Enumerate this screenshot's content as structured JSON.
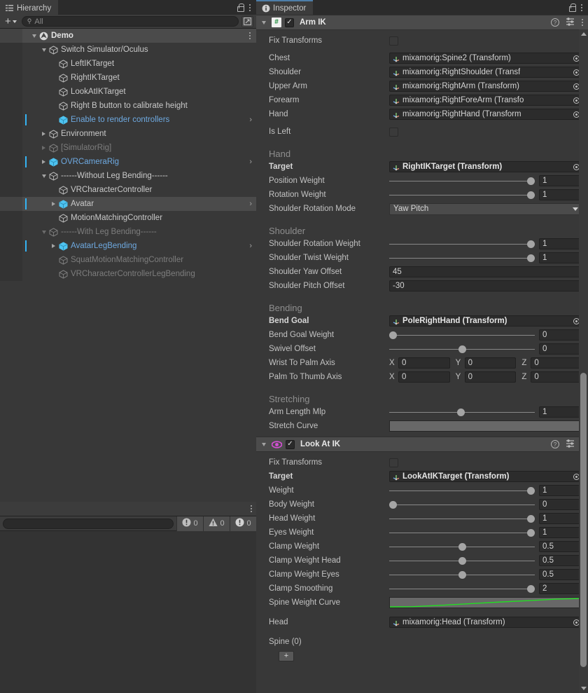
{
  "hierarchy": {
    "tab_label": "Hierarchy",
    "tab_icon": "hierarchy-icon",
    "lock_icon": "lock-icon",
    "menu_icon": "kebab-icon",
    "toolbar": {
      "create_label": "+",
      "search_placeholder": "All",
      "search_value": "",
      "search_icon": "search-icon",
      "filter_icon": "expand-window-icon"
    },
    "items": [
      {
        "label": "Demo",
        "indent": 0,
        "icon": "unity-scene-icon",
        "twisty": "down",
        "style": "white",
        "scene": true,
        "kebab": true
      },
      {
        "label": "Switch Simulator/Oculus",
        "indent": 1,
        "icon": "gameobject-icon",
        "twisty": "down",
        "style": "normal"
      },
      {
        "label": "LeftIKTarget",
        "indent": 2,
        "icon": "gameobject-icon",
        "twisty": "none",
        "style": "normal"
      },
      {
        "label": "RightIKTarget",
        "indent": 2,
        "icon": "gameobject-icon",
        "twisty": "none",
        "style": "normal"
      },
      {
        "label": "LookAtIKTarget",
        "indent": 2,
        "icon": "gameobject-icon",
        "twisty": "none",
        "style": "normal"
      },
      {
        "label": "Right B button to calibrate height",
        "indent": 2,
        "icon": "gameobject-icon",
        "twisty": "none",
        "style": "normal"
      },
      {
        "label": "Enable to render controllers",
        "indent": 2,
        "icon": "prefab-icon",
        "twisty": "none",
        "style": "blue",
        "prefab": true,
        "arrow": true
      },
      {
        "label": "Environment",
        "indent": 1,
        "icon": "gameobject-icon",
        "twisty": "right",
        "style": "normal"
      },
      {
        "label": "[SimulatorRig]",
        "indent": 1,
        "icon": "gameobject-icon",
        "twisty": "right",
        "style": "dim"
      },
      {
        "label": "OVRCameraRig",
        "indent": 1,
        "icon": "prefab-icon",
        "twisty": "right",
        "style": "blue",
        "prefab": true,
        "arrow": true
      },
      {
        "label": "------Without Leg Bending------",
        "indent": 1,
        "icon": "gameobject-icon",
        "twisty": "down",
        "style": "normal"
      },
      {
        "label": "VRCharacterController",
        "indent": 2,
        "icon": "gameobject-icon",
        "twisty": "none",
        "style": "normal"
      },
      {
        "label": "Avatar",
        "indent": 2,
        "icon": "prefab-icon",
        "twisty": "right",
        "style": "normal",
        "prefab": true,
        "arrow": true,
        "selected": true
      },
      {
        "label": "MotionMatchingController",
        "indent": 2,
        "icon": "gameobject-icon",
        "twisty": "none",
        "style": "normal"
      },
      {
        "label": "------With Leg Bending------",
        "indent": 1,
        "icon": "gameobject-icon",
        "twisty": "down",
        "style": "dim"
      },
      {
        "label": "AvatarLegBending",
        "indent": 2,
        "icon": "prefab-icon",
        "twisty": "right",
        "style": "blue",
        "prefab": true,
        "arrow": true
      },
      {
        "label": "SquatMotionMatchingController",
        "indent": 2,
        "icon": "gameobject-icon",
        "twisty": "none",
        "style": "dim"
      },
      {
        "label": "VRCharacterControllerLegBending",
        "indent": 2,
        "icon": "gameobject-icon",
        "twisty": "none",
        "style": "dim"
      }
    ]
  },
  "console": {
    "menu_icon": "kebab-icon",
    "search_value": "",
    "counts": [
      {
        "icon": "log-icon",
        "value": "0"
      },
      {
        "icon": "warning-icon",
        "value": "0"
      },
      {
        "icon": "error-icon",
        "value": "0"
      }
    ]
  },
  "inspector": {
    "tab_label": "Inspector",
    "tab_icon": "info-icon",
    "lock_icon": "lock-icon",
    "menu_icon": "kebab-icon",
    "components": [
      {
        "title": "Arm IK",
        "icon": "csharp-script-icon",
        "enabled": true,
        "help_icon": "help-icon",
        "preset_icon": "preset-icon",
        "menu_icon": "kebab-icon"
      },
      {
        "title": "Look At IK",
        "icon": "eye-icon",
        "enabled": true,
        "help_icon": "help-icon",
        "preset_icon": "preset-icon",
        "menu_icon": "kebab-icon"
      }
    ],
    "arm_ik": {
      "fix_transforms": {
        "label": "Fix Transforms",
        "checked": false
      },
      "refs": [
        {
          "label": "Chest",
          "value": "mixamorig:Spine2 (Transform)"
        },
        {
          "label": "Shoulder",
          "value": "mixamorig:RightShoulder (Transf"
        },
        {
          "label": "Upper Arm",
          "value": "mixamorig:RightArm (Transform)"
        },
        {
          "label": "Forearm",
          "value": "mixamorig:RightForeArm (Transfo"
        },
        {
          "label": "Hand",
          "value": "mixamorig:RightHand (Transform"
        }
      ],
      "is_left": {
        "label": "Is Left",
        "checked": false
      },
      "hand": {
        "title": "Hand",
        "target": {
          "label": "Target",
          "value": "RightIKTarget (Transform)"
        },
        "position_weight": {
          "label": "Position Weight",
          "value": "1",
          "pct": 100
        },
        "rotation_weight": {
          "label": "Rotation Weight",
          "value": "1",
          "pct": 100
        },
        "shoulder_rotation_mode": {
          "label": "Shoulder Rotation Mode",
          "value": "Yaw Pitch"
        }
      },
      "shoulder": {
        "title": "Shoulder",
        "rotation_weight": {
          "label": "Shoulder Rotation Weight",
          "value": "1",
          "pct": 100
        },
        "twist_weight": {
          "label": "Shoulder Twist Weight",
          "value": "1",
          "pct": 100
        },
        "yaw_offset": {
          "label": "Shoulder Yaw Offset",
          "value": "45"
        },
        "pitch_offset": {
          "label": "Shoulder Pitch Offset",
          "value": "-30"
        }
      },
      "bending": {
        "title": "Bending",
        "bend_goal": {
          "label": "Bend Goal",
          "value": "PoleRightHand (Transform)"
        },
        "bend_goal_weight": {
          "label": "Bend Goal Weight",
          "value": "0",
          "pct": 0
        },
        "swivel_offset": {
          "label": "Swivel Offset",
          "value": "0",
          "pct": 50
        },
        "wrist_to_palm_axis": {
          "label": "Wrist To Palm Axis",
          "x": "0",
          "y": "0",
          "z": "0"
        },
        "palm_to_thumb_axis": {
          "label": "Palm To Thumb Axis",
          "x": "0",
          "y": "0",
          "z": "0"
        }
      },
      "stretching": {
        "title": "Stretching",
        "arm_length_mlp": {
          "label": "Arm Length Mlp",
          "value": "1",
          "pct": 49
        },
        "stretch_curve": {
          "label": "Stretch Curve"
        }
      }
    },
    "look_at_ik": {
      "fix_transforms": {
        "label": "Fix Transforms",
        "checked": false
      },
      "target": {
        "label": "Target",
        "value": "LookAtIKTarget (Transform)"
      },
      "weight": {
        "label": "Weight",
        "value": "1",
        "pct": 100
      },
      "body_weight": {
        "label": "Body Weight",
        "value": "0",
        "pct": 0
      },
      "head_weight": {
        "label": "Head Weight",
        "value": "1",
        "pct": 100
      },
      "eyes_weight": {
        "label": "Eyes Weight",
        "value": "1",
        "pct": 100
      },
      "clamp_weight": {
        "label": "Clamp Weight",
        "value": "0.5",
        "pct": 50
      },
      "clamp_weight_head": {
        "label": "Clamp Weight Head",
        "value": "0.5",
        "pct": 50
      },
      "clamp_weight_eyes": {
        "label": "Clamp Weight Eyes",
        "value": "0.5",
        "pct": 50
      },
      "clamp_smoothing": {
        "label": "Clamp Smoothing",
        "value": "2",
        "pct": 100
      },
      "spine_weight_curve": {
        "label": "Spine Weight Curve"
      },
      "head": {
        "label": "Head",
        "value": "mixamorig:Head (Transform)"
      },
      "spine": {
        "label": "Spine (0)",
        "add_label": "+"
      }
    }
  },
  "colors": {
    "panel_bg": "#383838",
    "header_bg": "#3c3c3c",
    "selected_row": "#4b4b4b",
    "prefab_blue": "#6ea9e0",
    "prefab_marker": "#35b3f3",
    "tab_accent": "#4d7ea8",
    "curve_green": "#22dd22",
    "field_bg": "#2c2c2c"
  }
}
